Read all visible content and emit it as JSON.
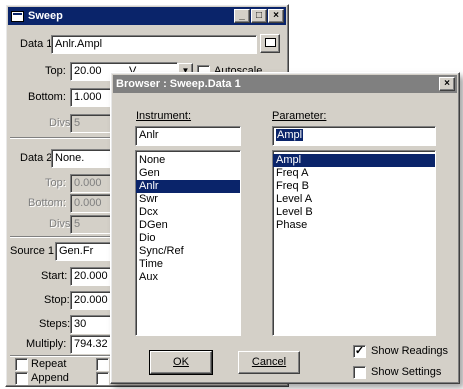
{
  "sweep": {
    "title": "Sweep",
    "data1_label": "Data 1:",
    "data1_value": "Anlr.Ampl",
    "top_label": "Top:",
    "top_value": "20.00",
    "top_unit": "V",
    "autoscale_label": "Autoscale",
    "bottom_label": "Bottom:",
    "bottom_value": "1.000",
    "divs_label": "Divs:",
    "divs_value": "5",
    "data2_label": "Data 2:",
    "data2_value": "None.",
    "top2_label": "Top:",
    "top2_value": "0.000",
    "bottom2_label": "Bottom:",
    "bottom2_value": "0.000",
    "divs2_label": "Divs:",
    "divs2_value": "5",
    "source1_label": "Source 1:",
    "source1_value": "Gen.Fr",
    "start_label": "Start:",
    "start_value": "20.000",
    "stop_label": "Stop:",
    "stop_value": "20.000",
    "steps_label": "Steps:",
    "steps_value": "30",
    "multiply_label": "Multiply:",
    "multiply_value": "794.32",
    "repeat_label": "Repeat",
    "append_label": "Append"
  },
  "browser": {
    "title": "Browser : Sweep.Data 1",
    "instrument_label": "Instrument:",
    "instrument_value": "Anlr",
    "instruments": [
      "None",
      "Gen",
      "Anlr",
      "Swr",
      "Dcx",
      "DGen",
      "Dio",
      "Sync/Ref",
      "Time",
      "Aux"
    ],
    "instrument_selected": "Anlr",
    "parameter_label": "Parameter:",
    "parameter_value": "Ampl",
    "parameters": [
      "Ampl",
      "Freq A",
      "Freq B",
      "Level A",
      "Level B",
      "Phase"
    ],
    "parameter_selected": "Ampl",
    "ok_label": "OK",
    "cancel_label": "Cancel",
    "show_readings_label": "Show Readings",
    "show_readings_checked": true,
    "show_settings_label": "Show Settings",
    "show_settings_checked": false
  }
}
